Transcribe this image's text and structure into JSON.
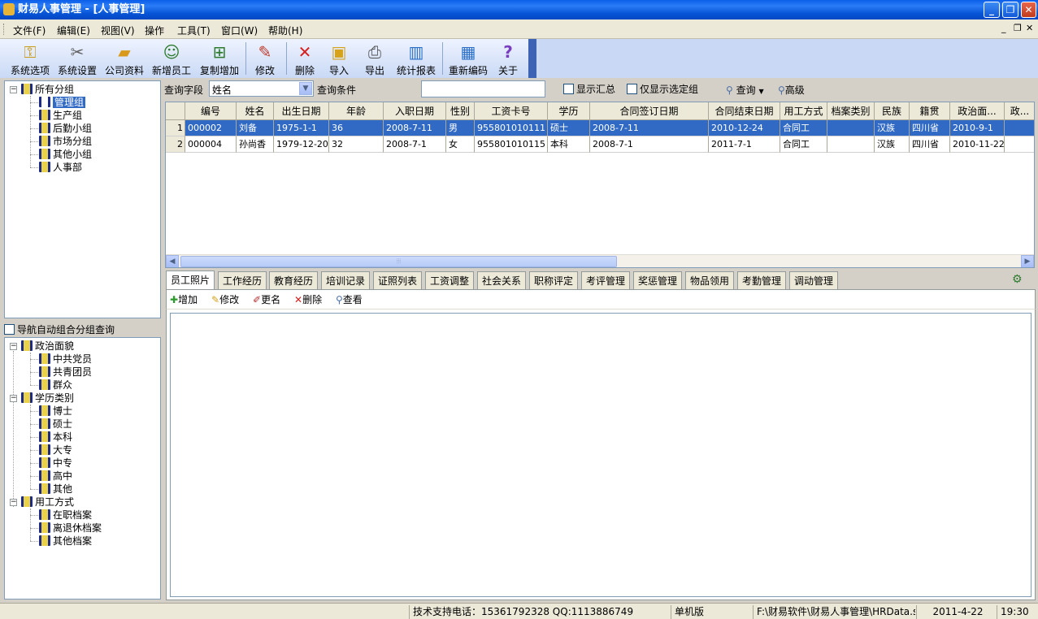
{
  "window": {
    "title": "财易人事管理 - [人事管理]"
  },
  "menu": [
    "文件(F)",
    "编辑(E)",
    "视图(V)",
    "操作",
    "工具(T)",
    "窗口(W)",
    "帮助(H)"
  ],
  "toolbar": {
    "items": [
      "系统选项",
      "系统设置",
      "公司资料",
      "新增员工",
      "复制增加",
      "修改",
      "删除",
      "导入",
      "导出",
      "统计报表",
      "重新编码",
      "关于"
    ]
  },
  "groups_tree": {
    "root": "所有分组",
    "children": [
      "管理组",
      "生产组",
      "后勤小组",
      "市场分组",
      "其他小组",
      "人事部"
    ],
    "selected": "管理组"
  },
  "nav_auto": {
    "label": "导航自动组合分组查询",
    "checked": false
  },
  "category_tree": [
    {
      "label": "政治面貌",
      "children": [
        "中共党员",
        "共青团员",
        "群众"
      ]
    },
    {
      "label": "学历类别",
      "children": [
        "博士",
        "硕士",
        "本科",
        "大专",
        "中专",
        "高中",
        "其他"
      ]
    },
    {
      "label": "用工方式",
      "children": [
        "在职档案",
        "离退休档案",
        "其他档案"
      ]
    }
  ],
  "query": {
    "field_label": "查询字段",
    "field_value": "姓名",
    "condition_label": "查询条件",
    "condition_value": "",
    "show_summary": "显示汇总",
    "only_selected": "仅显示选定组",
    "query_button": "查询",
    "advanced_button": "高级"
  },
  "grid": {
    "columns": [
      "编号",
      "姓名",
      "出生日期",
      "年龄",
      "入职日期",
      "性别",
      "工资卡号",
      "学历",
      "合同签订日期",
      "合同结束日期",
      "用工方式",
      "档案类别",
      "民族",
      "籍贯",
      "政治面...",
      "政..."
    ],
    "rows": [
      {
        "no": "1",
        "cells": [
          "000002",
          "刘备",
          "1975-1-1",
          "36",
          "2008-7-11",
          "男",
          "955801010111",
          "硕士",
          "2008-7-11",
          "2010-12-24",
          "合同工",
          "",
          "汉族",
          "四川省",
          "2010-9-1",
          ""
        ]
      },
      {
        "no": "2",
        "cells": [
          "000004",
          "孙尚香",
          "1979-12-20",
          "32",
          "2008-7-1",
          "女",
          "955801010115",
          "本科",
          "2008-7-1",
          "2011-7-1",
          "合同工",
          "",
          "汉族",
          "四川省",
          "2010-11-22",
          ""
        ]
      }
    ],
    "selected_row": 1
  },
  "tabs": [
    "员工照片",
    "工作经历",
    "教育经历",
    "培训记录",
    "证照列表",
    "工资调整",
    "社会关系",
    "职称评定",
    "考评管理",
    "奖惩管理",
    "物品领用",
    "考勤管理",
    "调动管理"
  ],
  "active_tab": "员工照片",
  "subtoolbar": [
    "增加",
    "修改",
    "更名",
    "删除",
    "查看"
  ],
  "status": {
    "support": "技术支持电话：15361792328 QQ:1113886749",
    "mode": "单机版",
    "path": "F:\\财易软件\\财易人事管理\\HRData.sj",
    "date": "2011-4-22",
    "time": "19:30"
  }
}
